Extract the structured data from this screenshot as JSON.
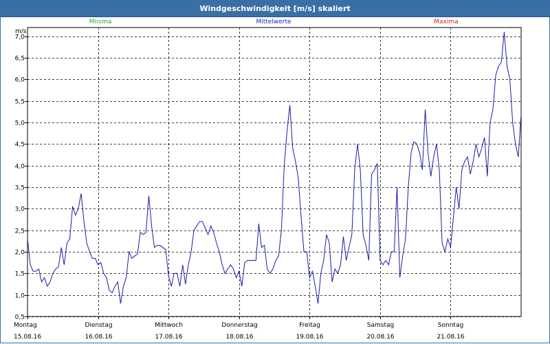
{
  "window": {
    "title": "Windgeschwindigkeit [m/s] skaliert"
  },
  "colors": {
    "minima": "#22aa22",
    "mittelwerte": "#2222cc",
    "maxima": "#cc2222",
    "line": "#1a1aaa",
    "titlebar": "#3a6fa6"
  },
  "chart_data": {
    "type": "line",
    "title": "Windgeschwindigkeit [m/s] skaliert",
    "ylabel": "m/s",
    "ylim": [
      0.5,
      7.2
    ],
    "yticks": [
      "0,5",
      "1,0",
      "1,5",
      "2,0",
      "2,5",
      "3,0",
      "3,5",
      "4,0",
      "4,5",
      "5,0",
      "5,5",
      "6,0",
      "6,5",
      "7,0"
    ],
    "ytick_values": [
      0.5,
      1.0,
      1.5,
      2.0,
      2.5,
      3.0,
      3.5,
      4.0,
      4.5,
      5.0,
      5.5,
      6.0,
      6.5,
      7.0
    ],
    "grid": true,
    "legend": [
      "Minima",
      "Mittelwerte",
      "Maxima"
    ],
    "xlim": [
      0,
      7
    ],
    "days": [
      {
        "name": "Montag",
        "date": "15.08.16"
      },
      {
        "name": "Dienstag",
        "date": "16.08.16"
      },
      {
        "name": "Mittwoch",
        "date": "17.08.16"
      },
      {
        "name": "Donnerstag",
        "date": "18.08.16"
      },
      {
        "name": "Freitag",
        "date": "19.08.16"
      },
      {
        "name": "Samstag",
        "date": "20.08.16"
      },
      {
        "name": "Sonntag",
        "date": "21.08.16"
      }
    ],
    "series": [
      {
        "name": "Mittelwerte",
        "values": [
          2.3,
          1.7,
          1.55,
          1.55,
          1.6,
          1.3,
          1.4,
          1.2,
          1.3,
          1.5,
          1.6,
          1.65,
          2.1,
          1.7,
          2.2,
          2.3,
          3.05,
          2.85,
          3.0,
          3.35,
          2.7,
          2.2,
          2.0,
          1.85,
          1.85,
          1.7,
          1.75,
          1.5,
          1.4,
          1.1,
          1.05,
          1.2,
          1.3,
          0.8,
          1.2,
          1.4,
          2.0,
          1.85,
          1.9,
          1.95,
          2.45,
          2.4,
          2.45,
          3.3,
          2.6,
          2.1,
          2.15,
          2.15,
          2.1,
          2.05,
          1.45,
          1.2,
          1.5,
          1.5,
          1.2,
          1.7,
          1.25,
          1.7,
          2.0,
          2.5,
          2.6,
          2.7,
          2.7,
          2.55,
          2.4,
          2.6,
          2.45,
          2.2,
          2.0,
          1.7,
          1.5,
          1.6,
          1.7,
          1.6,
          1.4,
          1.55,
          1.2,
          1.75,
          1.8,
          1.8,
          1.8,
          1.8,
          2.65,
          2.1,
          2.15,
          1.6,
          1.5,
          1.6,
          1.8,
          1.9,
          2.5,
          4.0,
          4.8,
          5.4,
          4.4,
          4.1,
          3.7,
          2.8,
          2.0,
          2.0,
          1.4,
          1.55,
          1.2,
          0.8,
          1.5,
          1.8,
          2.4,
          2.2,
          1.3,
          1.6,
          1.5,
          1.7,
          2.35,
          1.8,
          2.1,
          2.4,
          3.9,
          4.5,
          3.9,
          2.4,
          2.15,
          1.8,
          3.8,
          3.9,
          4.05,
          1.8,
          1.7,
          1.8,
          1.7,
          2.0,
          2.0,
          3.5,
          1.4,
          1.9,
          2.3,
          3.5,
          4.3,
          4.55,
          4.5,
          4.3,
          3.9,
          5.3,
          4.3,
          3.75,
          4.2,
          4.5,
          3.9,
          2.2,
          2.0,
          2.3,
          2.1,
          2.8,
          3.5,
          3.0,
          3.9,
          4.1,
          4.2,
          3.8,
          4.1,
          4.5,
          4.2,
          4.4,
          4.65,
          3.75,
          5.0,
          5.3,
          6.1,
          6.3,
          6.4,
          7.1,
          6.3,
          6.0,
          5.0,
          4.5,
          4.2,
          5.2
        ]
      }
    ]
  }
}
